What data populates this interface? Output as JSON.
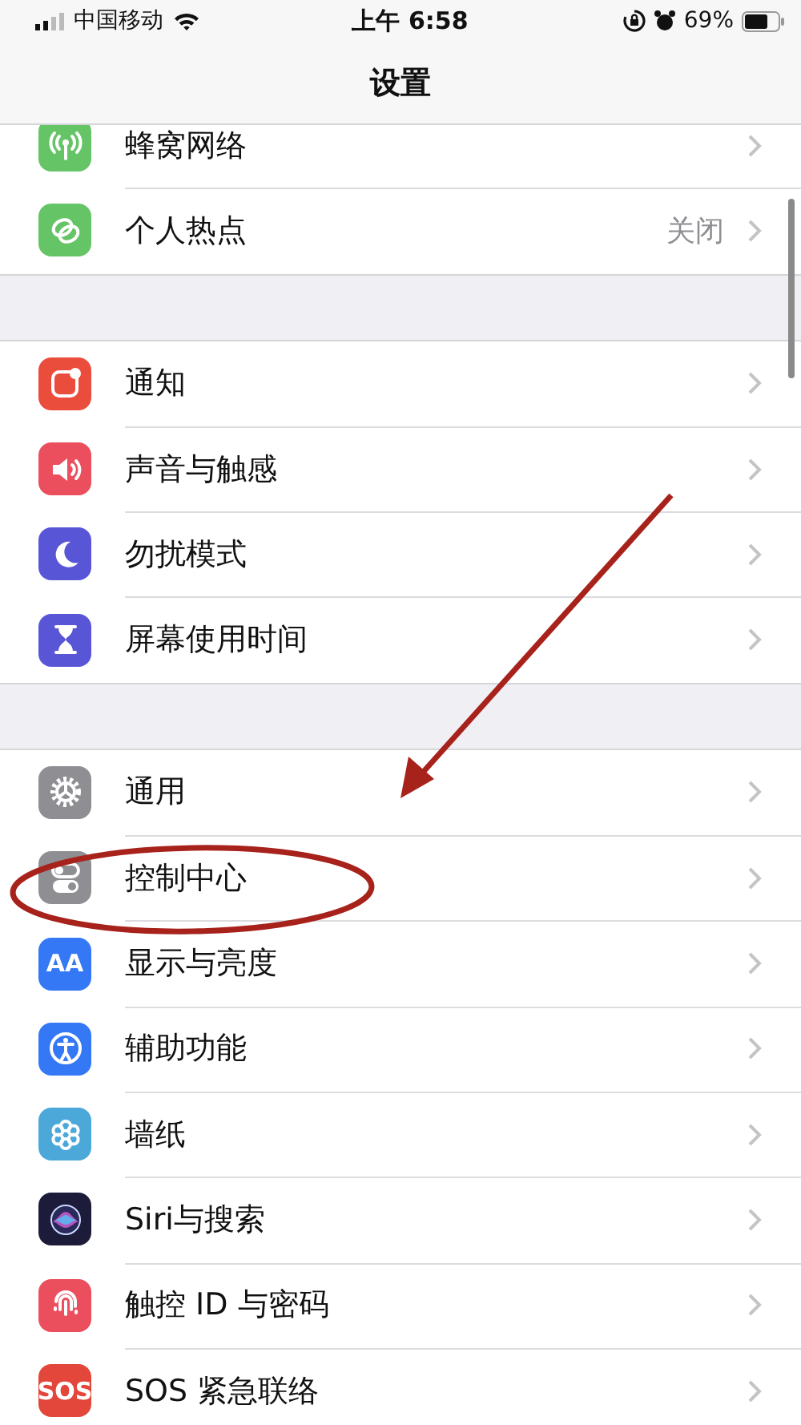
{
  "status_bar": {
    "carrier": "中国移动",
    "time": "上午 6:58",
    "battery_percent": "69%"
  },
  "nav_bar": {
    "title": "设置"
  },
  "groups": [
    {
      "rows": [
        {
          "kind": "cellular",
          "color": "#65c466",
          "label": "蜂窝网络"
        },
        {
          "kind": "hotspot",
          "color": "#65c466",
          "label": "个人热点",
          "detail": "关闭"
        }
      ]
    },
    {
      "rows": [
        {
          "kind": "notifications",
          "color": "#eb4d3d",
          "label": "通知"
        },
        {
          "kind": "sounds",
          "color": "#eb4e5d",
          "label": "声音与触感"
        },
        {
          "kind": "moon",
          "color": "#5856d6",
          "label": "勿扰模式"
        },
        {
          "kind": "hourglass",
          "color": "#5856d6",
          "label": "屏幕使用时间"
        }
      ]
    },
    {
      "rows": [
        {
          "kind": "gear",
          "color": "#8e8e93",
          "label": "通用"
        },
        {
          "kind": "switches",
          "color": "#8e8e93",
          "label": "控制中心"
        },
        {
          "kind": "text",
          "color": "#3478f6",
          "label": "显示与亮度",
          "icon_text": "AA"
        },
        {
          "kind": "accessibility",
          "color": "#3478f6",
          "label": "辅助功能"
        },
        {
          "kind": "flower",
          "color": "#4da8da",
          "label": "墙纸"
        },
        {
          "kind": "siri",
          "color": "#1c1c3a",
          "label": "Siri与搜索"
        },
        {
          "kind": "fingerprint",
          "color": "#eb4e5d",
          "label": "触控 ID 与密码"
        },
        {
          "kind": "text",
          "color": "#e3463a",
          "label": "SOS 紧急联络",
          "icon_text": "SOS"
        }
      ]
    }
  ],
  "arrow": {
    "color": "#a8221c"
  },
  "ellipse": {
    "color": "#a8221c"
  }
}
